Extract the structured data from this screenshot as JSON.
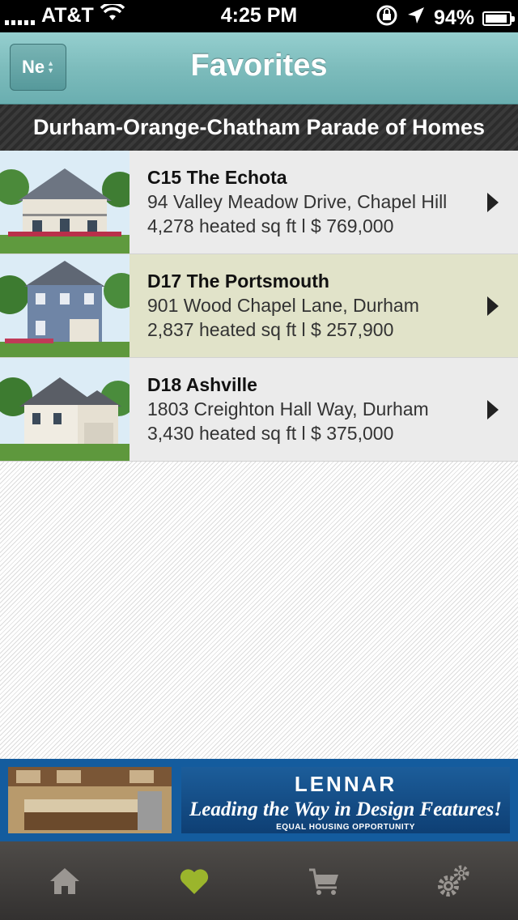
{
  "status_bar": {
    "carrier": "AT&T",
    "time": "4:25 PM",
    "battery": "94%",
    "battery_level": 0.94
  },
  "nav": {
    "title": "Favorites",
    "left_button": "Ne"
  },
  "section_title": "Durham-Orange-Chatham Parade of Homes",
  "homes": [
    {
      "name": "C15 The Echota",
      "address": "94 Valley Meadow Drive, Chapel Hill",
      "details": "4,278 heated sq ft l $ 769,000"
    },
    {
      "name": "D17 The Portsmouth",
      "address": "901 Wood Chapel Lane, Durham",
      "details": "2,837 heated sq ft l $ 257,900"
    },
    {
      "name": "D18 Ashville",
      "address": "1803 Creighton Hall Way, Durham",
      "details": "3,430 heated sq ft l $ 375,000"
    }
  ],
  "banner": {
    "brand": "LENNAR",
    "slogan": "Leading the Way in Design Features!",
    "footer": "EQUAL HOUSING OPPORTUNITY"
  },
  "tabs": [
    {
      "icon": "home-icon"
    },
    {
      "icon": "heart-icon",
      "active": true
    },
    {
      "icon": "cart-icon"
    },
    {
      "icon": "gear-icon"
    }
  ],
  "colors": {
    "nav_teal": "#7dbcbc",
    "row_highlight": "#e1e3c9",
    "active_tab": "#9bb52c",
    "inactive_tab": "#9a9692"
  }
}
